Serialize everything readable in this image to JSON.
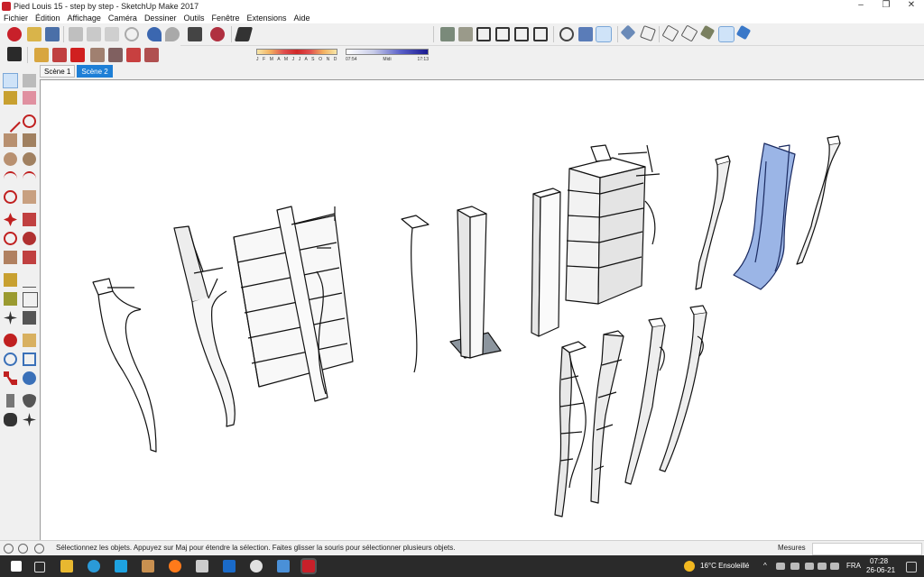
{
  "window": {
    "title": "Pied Louis 15 - step by step - SketchUp Make 2017"
  },
  "window_controls": {
    "minimize": "–",
    "maximize": "❐",
    "close": "✕"
  },
  "menu": [
    "Fichier",
    "Édition",
    "Affichage",
    "Caméra",
    "Dessiner",
    "Outils",
    "Fenêtre",
    "Extensions",
    "Aide"
  ],
  "shadow_settings": {
    "months_label": "J F M A M J J A S O N D",
    "time_start": "07:54",
    "time_mid": "Midi",
    "time_end": "17:13"
  },
  "scenes": {
    "tabs": [
      "Scène 1",
      "Scène 2"
    ],
    "active": "Scène 2"
  },
  "status": {
    "message": "Sélectionnez les objets. Appuyez sur Maj pour étendre la sélection. Faites glisser la souris pour sélectionner plusieurs objets.",
    "measures_label": "Mesures",
    "measures_value": ""
  },
  "taskbar": {
    "weather": "16°C  Ensoleillé",
    "language": "FRA",
    "time": "07:28",
    "date": "26-06-21"
  },
  "colors": {
    "selection_blue": "#9bb5e6",
    "active_tab": "#1e7fd6",
    "brand_red": "#c8202a"
  }
}
